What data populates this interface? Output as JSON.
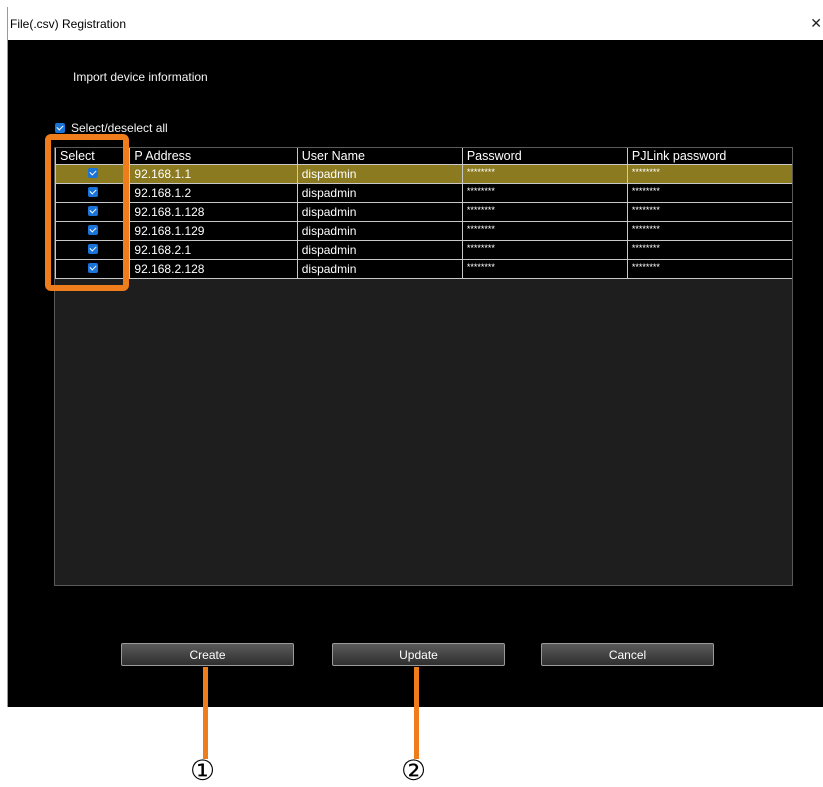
{
  "window": {
    "title": "File(.csv) Registration",
    "close_glyph": "✕"
  },
  "subtitle": "Import device information",
  "select_all": {
    "label": "Select/deselect all",
    "checked": true
  },
  "table": {
    "columns": [
      "Select",
      "P Address",
      "User Name",
      "Password",
      "PJLink password"
    ],
    "rows": [
      {
        "checked": true,
        "ip": "92.168.1.1",
        "user": "dispadmin",
        "password": "********",
        "pjlink": "********",
        "highlighted": true
      },
      {
        "checked": true,
        "ip": "92.168.1.2",
        "user": "dispadmin",
        "password": "********",
        "pjlink": "********",
        "highlighted": false
      },
      {
        "checked": true,
        "ip": "92.168.1.128",
        "user": "dispadmin",
        "password": "********",
        "pjlink": "********",
        "highlighted": false
      },
      {
        "checked": true,
        "ip": "92.168.1.129",
        "user": "dispadmin",
        "password": "********",
        "pjlink": "********",
        "highlighted": false
      },
      {
        "checked": true,
        "ip": "92.168.2.1",
        "user": "dispadmin",
        "password": "********",
        "pjlink": "********",
        "highlighted": false
      },
      {
        "checked": true,
        "ip": "92.168.2.128",
        "user": "dispadmin",
        "password": "********",
        "pjlink": "********",
        "highlighted": false
      }
    ]
  },
  "buttons": {
    "create": "Create",
    "update": "Update",
    "cancel": "Cancel"
  },
  "annotations": {
    "callout_1": "①",
    "callout_2": "②"
  },
  "colors": {
    "highlight_row": "#8b7a1f",
    "accent_orange": "#f07d1c",
    "checkbox_blue": "#1a73d9"
  }
}
